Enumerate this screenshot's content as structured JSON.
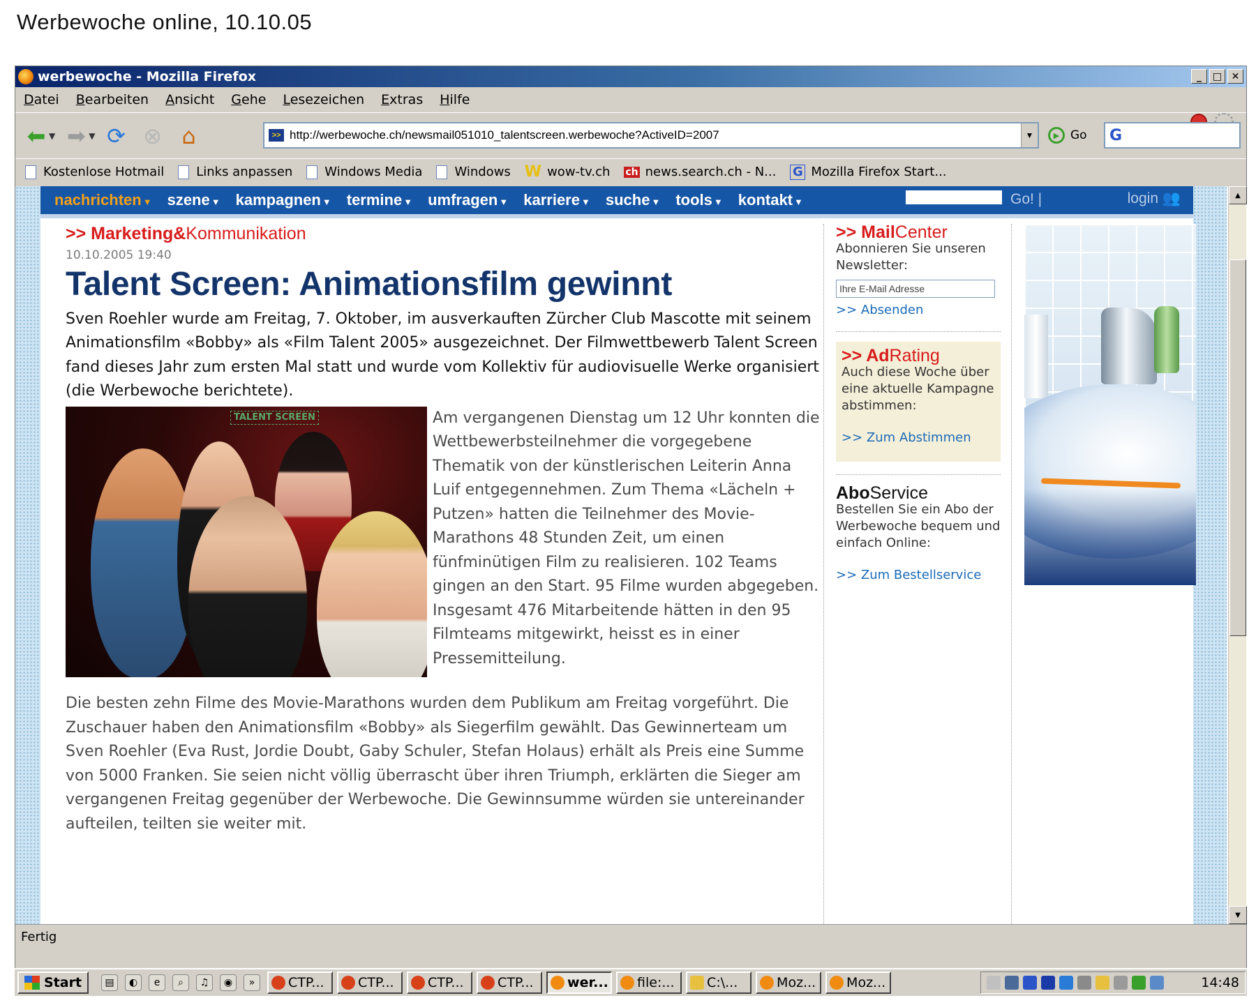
{
  "caption": "Werbewoche online, 10.10.05",
  "window": {
    "title": "werbewoche - Mozilla Firefox",
    "min": "_",
    "max": "□",
    "close": "✕"
  },
  "menu": [
    "Datei",
    "Bearbeiten",
    "Ansicht",
    "Gehe",
    "Lesezeichen",
    "Extras",
    "Hilfe"
  ],
  "toolbar": {
    "url": "http://werbewoche.ch/newsmail051010_talentscreen.werbewoche?ActiveID=2007",
    "go_label": "Go",
    "search_value": "G"
  },
  "bookmarks": [
    "Kostenlose Hotmail",
    "Links anpassen",
    "Windows Media",
    "Windows",
    "wow-tv.ch",
    "news.search.ch - N...",
    "Mozilla Firefox Start..."
  ],
  "site_nav": {
    "items": [
      "nachrichten",
      "szene",
      "kampagnen",
      "termine",
      "umfragen",
      "karriere",
      "suche",
      "tools",
      "kontakt"
    ],
    "go_label": "Go! |",
    "login_label": "login"
  },
  "article": {
    "section_prefix": ">> ",
    "section_bold": "Marketing&",
    "section_rest": "Kommunikation",
    "date": "10.10.2005 19:40",
    "headline": "Talent Screen: Animationsfilm gewinnt",
    "lead": "Sven Roehler wurde am Freitag, 7. Oktober, im ausverkauften Zürcher Club Mascotte mit seinem Animationsfilm «Bobby» als «Film Talent 2005» ausgezeichnet. Der Filmwettbewerb Talent Screen fand dieses Jahr zum ersten Mal statt und wurde vom Kollektiv für audiovisuelle Werke organisiert (die Werbewoche berichtete).",
    "photo_sign": "TALENT SCREEN",
    "body1": "Am vergangenen Dienstag um 12 Uhr konnten die Wettbewerbsteilnehmer die vorgegebene Thematik von der künstlerischen Leiterin Anna Luif entgegennehmen. Zum Thema «Lächeln + Putzen» hatten die Teilnehmer des Movie-Marathons 48 Stunden Zeit, um einen fünfminütigen Film zu realisieren. 102 Teams gingen an den Start. 95 Filme wurden abgegeben. Insgesamt 476 Mitarbeitende hätten in den 95 Filmteams mitgewirkt, heisst es in einer Pressemitteilung.",
    "body2": "Die besten zehn Filme des Movie-Marathons wurden dem Publikum am Freitag vorgeführt. Die Zuschauer haben den Animationsfilm «Bobby» als Siegerfilm gewählt. Das Gewinnerteam um Sven Roehler (Eva Rust, Jordie Doubt, Gaby Schuler, Stefan Holaus) erhält als Preis eine Summe von 5000 Franken. Sie seien nicht völlig überrascht über ihren Triumph, erklärten die Sieger am vergangenen Freitag gegenüber der Werbewoche. Die Gewinnsumme würden sie untereinander aufteilen, teilten sie weiter mit."
  },
  "sidebar": {
    "mail": {
      "prefix": ">> ",
      "bold": "Mail",
      "rest": "Center",
      "text": "Abonnieren Sie unseren Newsletter:",
      "input_placeholder": "Ihre E-Mail Adresse",
      "link": ">> Absenden"
    },
    "adrating": {
      "prefix": ">> ",
      "bold": "Ad",
      "rest": "Rating",
      "text": "Auch diese Woche über eine aktuelle Kampagne abstimmen:",
      "link": ">> Zum Abstimmen"
    },
    "abo": {
      "bold": "Abo",
      "rest": "Service",
      "text": "Bestellen Sie ein Abo der Werbewoche bequem und einfach Online:",
      "link": ">> Zum Bestellservice"
    }
  },
  "status": "Fertig",
  "taskbar": {
    "start": "Start",
    "items": [
      "CTP...",
      "CTP...",
      "CTP...",
      "CTP...",
      "wer...",
      "file:...",
      "C:\\...",
      "Moz...",
      "Moz..."
    ],
    "clock": "14:48"
  },
  "colors": {
    "nav_blue": "#1656a6",
    "nav_active": "#f3a019",
    "accent_red": "#d81b1b",
    "headline": "#13346a",
    "link": "#1a6ab8"
  }
}
